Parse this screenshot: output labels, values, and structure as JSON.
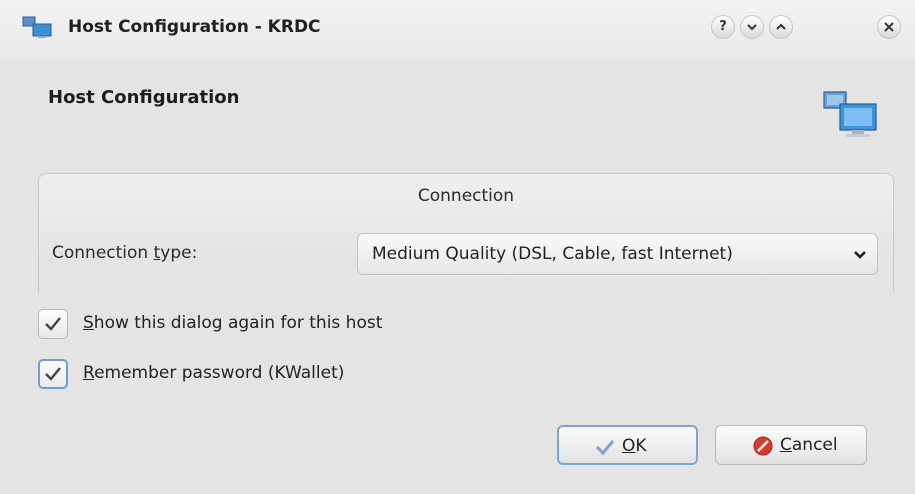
{
  "window": {
    "title": "Host Configuration - KRDC",
    "buttons": {
      "help": "?",
      "minimize": "⌄",
      "maximize": "⌃",
      "close": "×"
    }
  },
  "dialog": {
    "heading": "Host Configuration",
    "connection_group": {
      "title": "Connection",
      "type_label_pre": "Connection ",
      "type_label_mnemonic": "t",
      "type_label_post": "ype:",
      "type_value": "Medium Quality (DSL, Cable, fast Internet)"
    },
    "checkboxes": [
      {
        "mnemonic": "S",
        "rest": "how this dialog again for this host",
        "checked": true
      },
      {
        "mnemonic": "R",
        "rest": "emember password (KWallet)",
        "checked": true
      }
    ],
    "ok_button": {
      "mnemonic": "O",
      "rest": "K"
    },
    "cancel_button": {
      "mnemonic": "C",
      "rest": "ancel"
    }
  },
  "colors": {
    "window_bg": "#e4e4e4",
    "focus_blue": "#6d9ed4",
    "cancel_red": "#d83c2c"
  }
}
